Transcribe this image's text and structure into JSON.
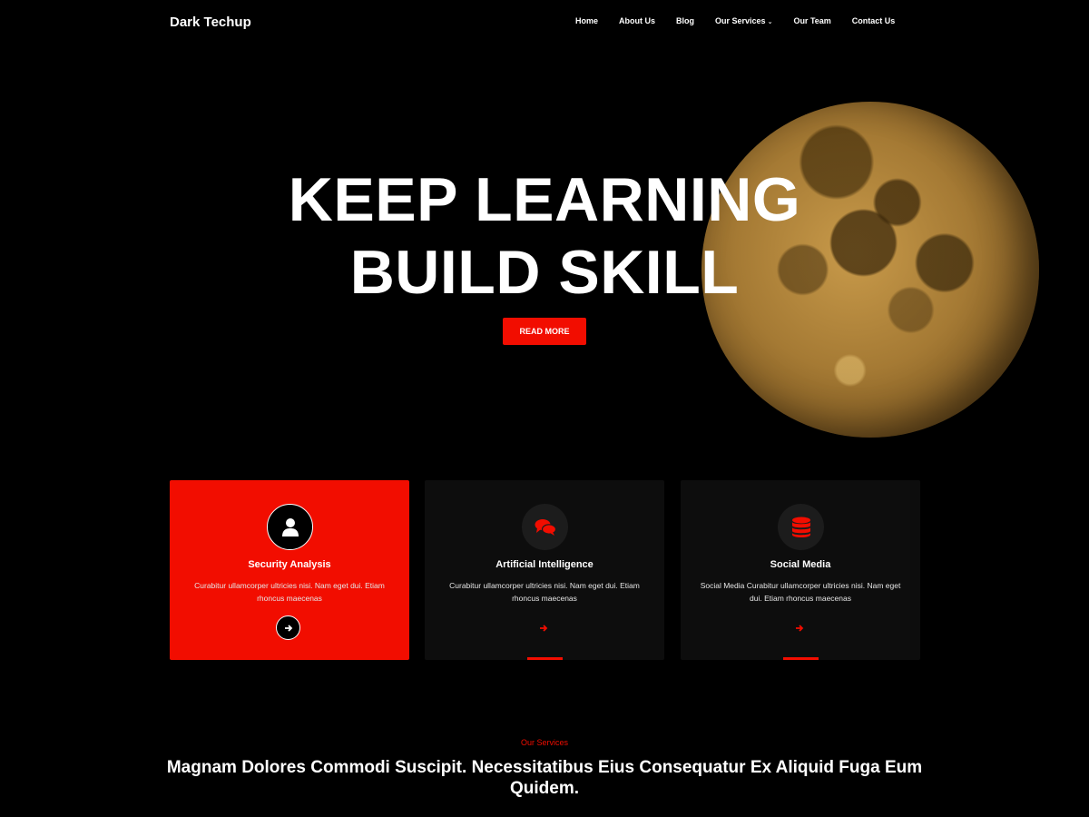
{
  "header": {
    "logo": "Dark Techup",
    "nav": [
      {
        "label": "Home"
      },
      {
        "label": "About Us"
      },
      {
        "label": "Blog"
      },
      {
        "label": "Our Services",
        "has_dropdown": true
      },
      {
        "label": "Our Team"
      },
      {
        "label": "Contact Us"
      }
    ]
  },
  "hero": {
    "title_line1": "KEEP LEARNING",
    "title_line2": "BUILD SKILL",
    "cta_label": "READ MORE"
  },
  "cards": [
    {
      "icon": "user-icon",
      "title": "Security Analysis",
      "text": "Curabitur ullamcorper ultricies nisi. Nam eget dui. Etiam rhoncus maecenas",
      "active": true
    },
    {
      "icon": "chat-bubbles-icon",
      "title": "Artificial Intelligence",
      "text": "Curabitur ullamcorper ultricies nisi. Nam eget dui. Etiam rhoncus maecenas",
      "active": false
    },
    {
      "icon": "database-icon",
      "title": "Social Media",
      "text": "Social Media Curabitur ullamcorper ultricies nisi. Nam eget dui. Etiam rhoncus maecenas",
      "active": false
    }
  ],
  "services": {
    "label": "Our Services",
    "heading": "Magnam Dolores Commodi Suscipit. Necessitatibus Eius Consequatur Ex Aliquid Fuga Eum Quidem."
  },
  "colors": {
    "accent": "#f20d00",
    "background": "#000000",
    "card_bg": "#0d0d0d"
  }
}
